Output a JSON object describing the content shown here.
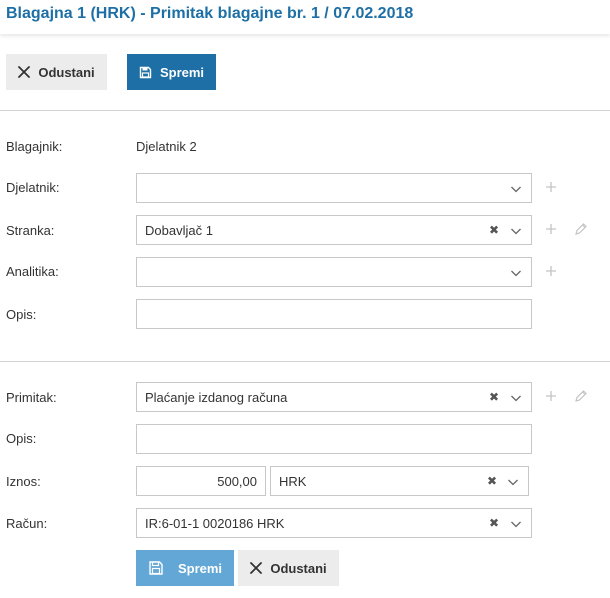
{
  "header": {
    "title": "Blagajna 1 (HRK) - Primitak blagajne br. 1 / 07.02.2018"
  },
  "toolbar": {
    "cancel_label": "Odustani",
    "save_label": "Spremi"
  },
  "form": {
    "cashier": {
      "label": "Blagajnik:",
      "value": "Djelatnik 2"
    },
    "employee": {
      "label": "Djelatnik:",
      "value": ""
    },
    "party": {
      "label": "Stranka:",
      "value": "Dobavljač 1"
    },
    "analytics": {
      "label": "Analitika:",
      "value": ""
    },
    "description": {
      "label": "Opis:",
      "value": ""
    }
  },
  "item": {
    "receipt": {
      "label": "Primitak:",
      "value": "Plaćanje izdanog računa"
    },
    "description": {
      "label": "Opis:",
      "value": ""
    },
    "amount": {
      "label": "Iznos:",
      "value": "500,00",
      "currency": "HRK"
    },
    "invoice": {
      "label": "Račun:",
      "value": "IR:6-01-1 0020186 HRK"
    },
    "save_label": "Spremi",
    "cancel_label": "Odustani"
  },
  "colors": {
    "accent": "#1d6fa5",
    "accent_light": "#63a7d6",
    "secondary_button": "#ececec"
  },
  "icons": {
    "cancel": "close-icon",
    "save": "floppy-disk-icon",
    "add": "plus-icon",
    "edit": "pencil-icon",
    "dropdown": "chevron-down-icon",
    "clear": "clear-x-icon"
  }
}
